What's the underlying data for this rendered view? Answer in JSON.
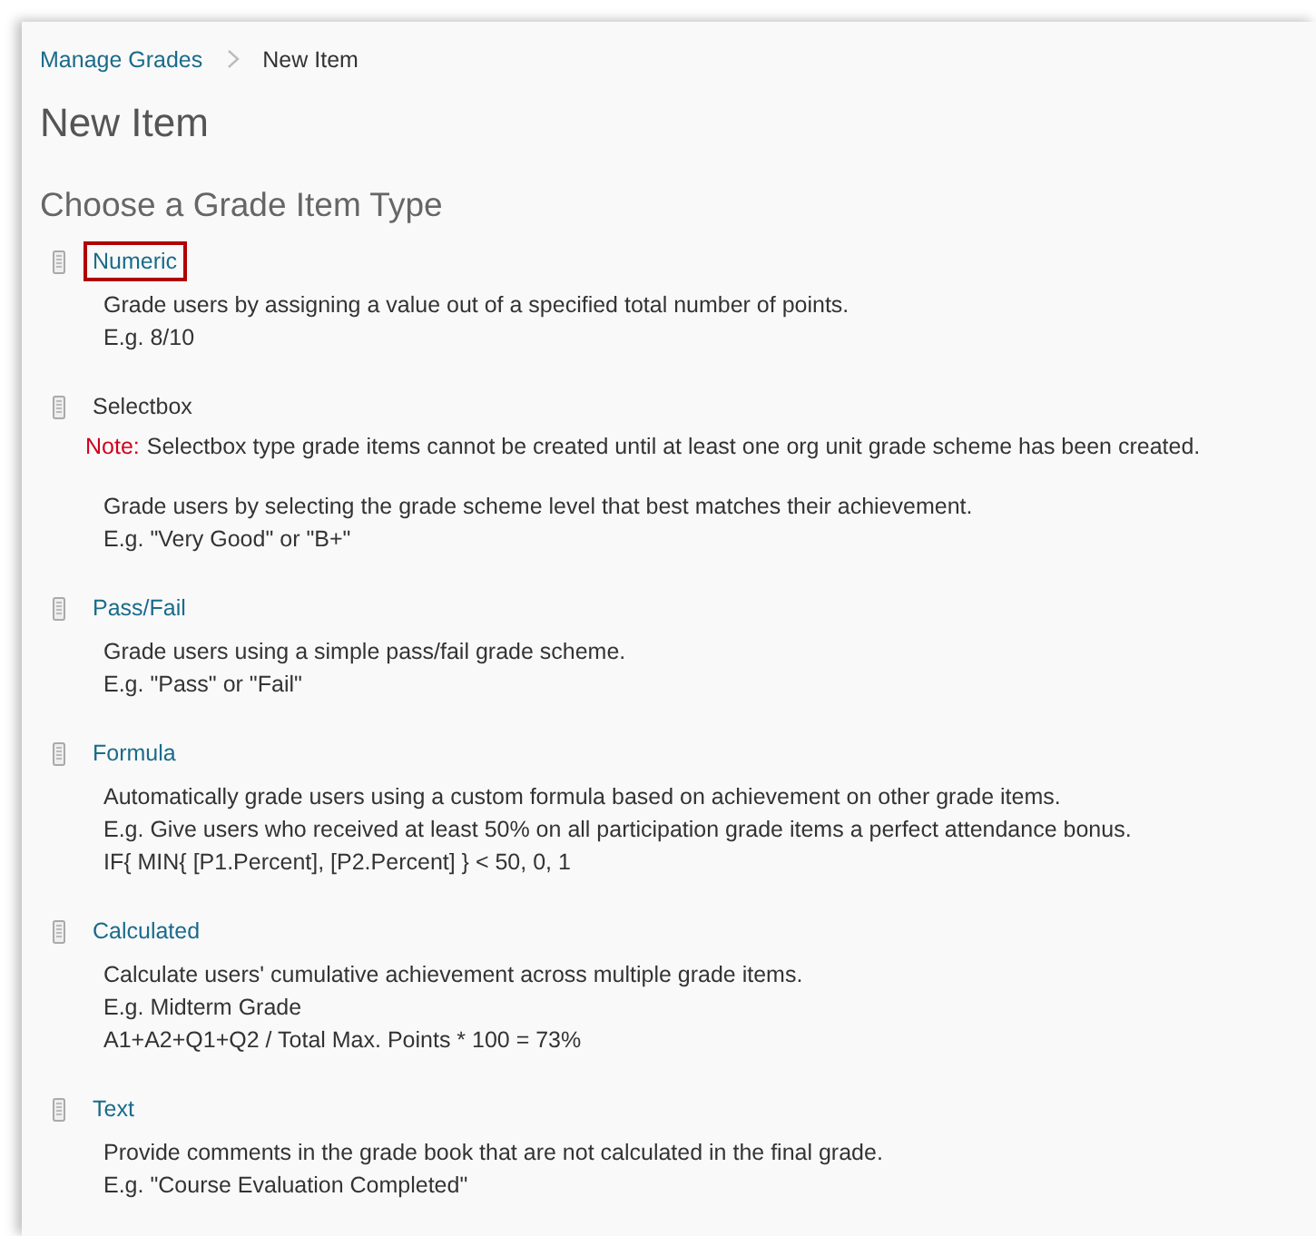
{
  "breadcrumb": [
    {
      "label": "Manage Grades",
      "kind": "link"
    },
    {
      "label": "New Item",
      "kind": "current"
    }
  ],
  "title": "New Item",
  "heading": "Choose a Grade Item Type",
  "item_types": [
    {
      "name": "Numeric",
      "disabled": false,
      "highlighted": true,
      "lines": [
        "Grade users by assigning a value out of a specified total number of points.",
        "E.g. 8/10"
      ]
    },
    {
      "name": "Selectbox",
      "disabled": true,
      "highlighted": false,
      "note_label": "Note:",
      "note": "Selectbox type grade items cannot be created until at least one org unit grade scheme has been created.",
      "lines": [
        "Grade users by selecting the grade scheme level that best matches their achievement.",
        "E.g. \"Very Good\" or \"B+\""
      ]
    },
    {
      "name": "Pass/Fail",
      "disabled": false,
      "highlighted": false,
      "lines": [
        "Grade users using a simple pass/fail grade scheme.",
        "E.g. \"Pass\" or \"Fail\""
      ]
    },
    {
      "name": "Formula",
      "disabled": false,
      "highlighted": false,
      "lines": [
        "Automatically grade users using a custom formula based on achievement on other grade items.",
        "E.g. Give users who received at least 50% on all participation grade items a perfect attendance bonus.",
        "IF{ MIN{ [P1.Percent], [P2.Percent] } < 50, 0, 1"
      ]
    },
    {
      "name": "Calculated",
      "disabled": false,
      "highlighted": false,
      "lines": [
        "Calculate users' cumulative achievement across multiple grade items.",
        "E.g. Midterm Grade",
        "A1+A2+Q1+Q2 / Total Max. Points * 100 = 73%"
      ]
    },
    {
      "name": "Text",
      "disabled": false,
      "highlighted": false,
      "lines": [
        "Provide comments in the grade book that are not calculated in the final grade.",
        "E.g. \"Course Evaluation Completed\""
      ]
    }
  ]
}
